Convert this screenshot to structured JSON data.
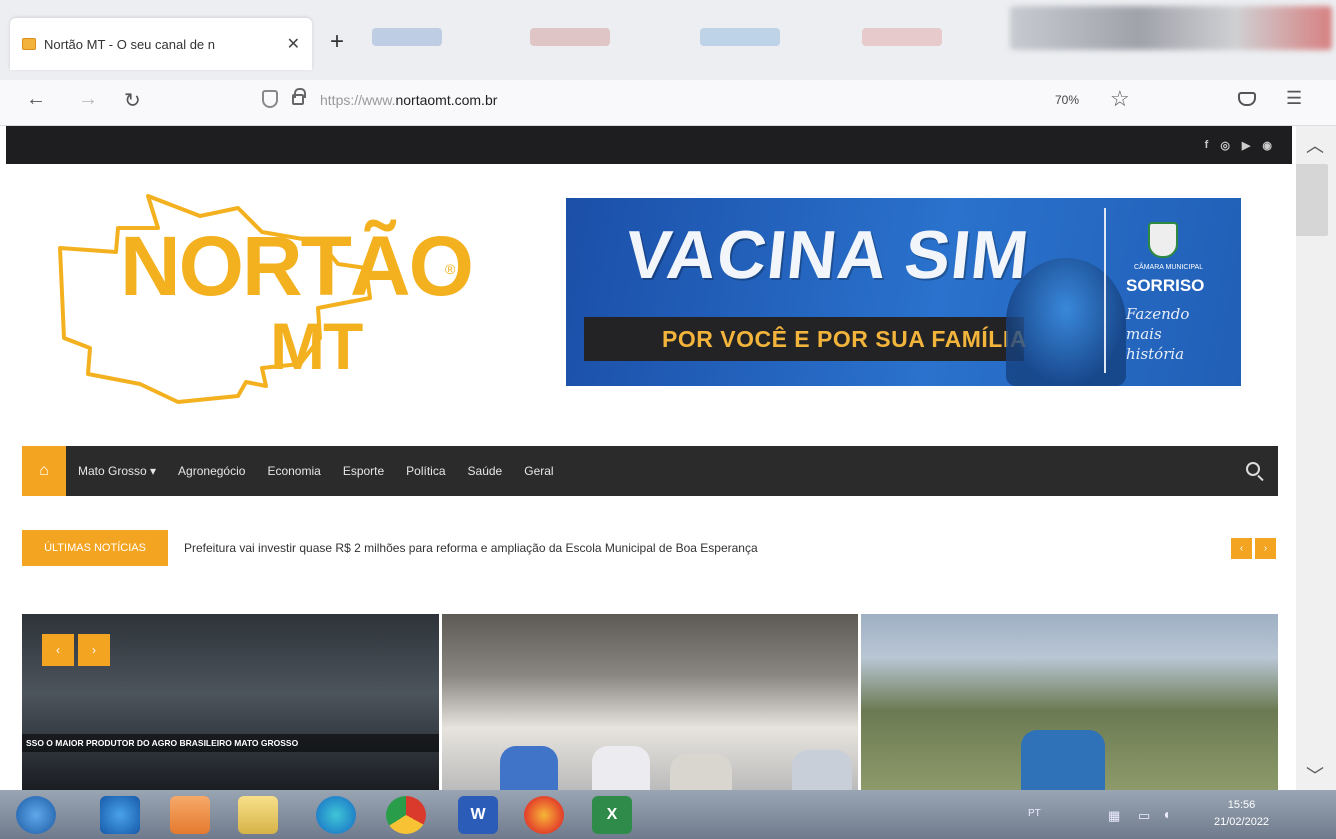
{
  "browser": {
    "tab_title": "Nortão MT - O seu canal de n",
    "new_tab_label": "+",
    "close_label": "✕",
    "url_prefix": "https://www.",
    "url_domain": "nortaomt.com.br",
    "zoom": "70%"
  },
  "site": {
    "logo_line1": "NORTÃO",
    "logo_line2": "MT",
    "logo_reg": "®",
    "social": [
      "f",
      "◎",
      "▶",
      "◉"
    ]
  },
  "banner": {
    "headline": "VACINA SIM",
    "subline": "POR VOCÊ E POR SUA FAMÍLIA",
    "crest_caption": "CÂMARA MUNICIPAL",
    "crest_name": "SORRISO",
    "crest_slogan": "Fazendo mais história"
  },
  "nav": {
    "items": [
      "Mato Grosso ▾",
      "Agronegócio",
      "Economia",
      "Esporte",
      "Política",
      "Saúde",
      "Geral"
    ]
  },
  "ticker": {
    "label": "ÚLTIMAS NOTÍCIAS",
    "headline": "Prefeitura vai investir quase R$ 2 milhões para reforma e ampliação da Escola Municipal de Boa Esperança",
    "prev": "‹",
    "next": "›"
  },
  "grid": {
    "caption": "SSO O MAIOR PRODUTOR DO AGRO BRASILEIRO    MATO GROSSO",
    "prev": "‹",
    "next": "›"
  },
  "taskbar": {
    "apps": [
      "Start",
      "Internet Explorer",
      "Media Player",
      "Explorer",
      "Edge",
      "Chrome",
      "Word",
      "Firefox",
      "Excel"
    ],
    "word_label": "W",
    "excel_label": "X",
    "tray": "PT",
    "time": "15:56",
    "date": "21/02/2022"
  },
  "colors": {
    "accent": "#f3a421",
    "nav_dark": "#2b2b2b",
    "banner_blue": "#2a72cd"
  }
}
